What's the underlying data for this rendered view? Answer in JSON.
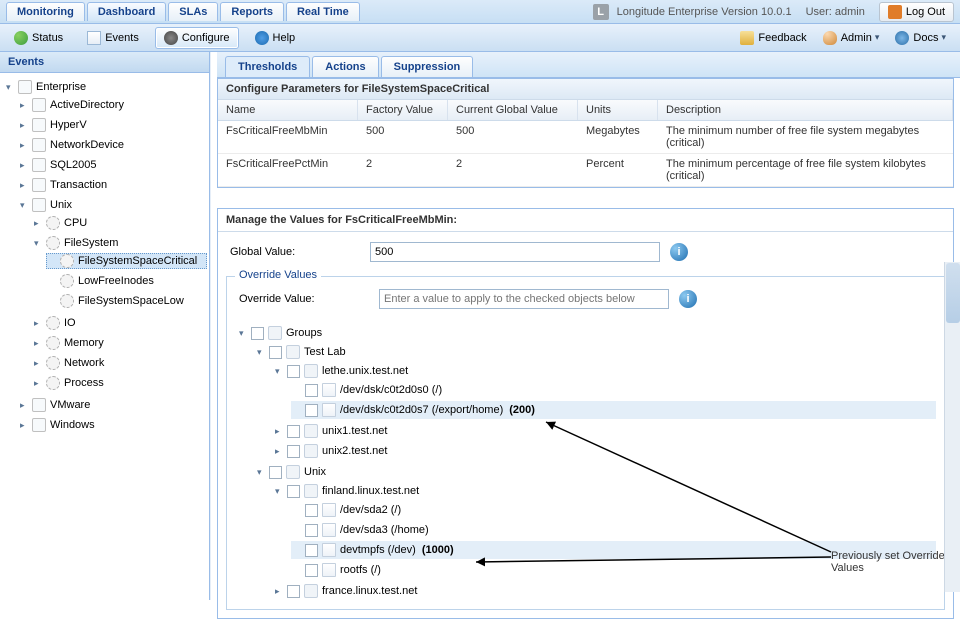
{
  "top": {
    "tabs": [
      "Monitoring",
      "Dashboard",
      "SLAs",
      "Reports",
      "Real Time"
    ],
    "active_tab": 1,
    "version": "Longitude Enterprise Version 10.0.1",
    "user_label": "User: admin",
    "logout": "Log Out"
  },
  "toolbar": {
    "status": "Status",
    "events": "Events",
    "configure": "Configure",
    "help": "Help",
    "feedback": "Feedback",
    "admin": "Admin",
    "docs": "Docs"
  },
  "sidebar": {
    "title": "Events",
    "root": "Enterprise",
    "items": [
      "ActiveDirectory",
      "HyperV",
      "NetworkDevice",
      "SQL2005",
      "Transaction"
    ],
    "unix": {
      "label": "Unix",
      "cpu": "CPU",
      "filesystem": "FileSystem",
      "fs_children": [
        "FileSystemSpaceCritical",
        "LowFreeInodes",
        "FileSystemSpaceLow"
      ],
      "others": [
        "IO",
        "Memory",
        "Network",
        "Process"
      ]
    },
    "vmware": "VMware",
    "windows": "Windows"
  },
  "subtabs": {
    "items": [
      "Thresholds",
      "Actions",
      "Suppression"
    ],
    "active": 0
  },
  "params": {
    "title": "Configure Parameters for FileSystemSpaceCritical",
    "cols": {
      "name": "Name",
      "fv": "Factory Value",
      "cgv": "Current Global Value",
      "units": "Units",
      "desc": "Description"
    },
    "rows": [
      {
        "name": "FsCriticalFreeMbMin",
        "fv": "500",
        "cgv": "500",
        "units": "Megabytes",
        "desc": "The minimum number of free file system megabytes (critical)"
      },
      {
        "name": "FsCriticalFreePctMin",
        "fv": "2",
        "cgv": "2",
        "units": "Percent",
        "desc": "The minimum percentage of free file system kilobytes (critical)"
      }
    ]
  },
  "manage": {
    "title": "Manage the Values for FsCriticalFreeMbMin:",
    "global_label": "Global Value:",
    "global_value": "500",
    "override_section": "Override Values",
    "override_label": "Override Value:",
    "override_placeholder": "Enter a value to apply to the checked objects below",
    "tree": {
      "groups": "Groups",
      "testlab": "Test Lab",
      "lethe": "lethe.unix.test.net",
      "lethe_kids": [
        {
          "label": "/dev/dsk/c0t2d0s0 (/)"
        },
        {
          "label": "/dev/dsk/c0t2d0s7 (/export/home)",
          "val": "(200)"
        }
      ],
      "unix1": "unix1.test.net",
      "unix2": "unix2.test.net",
      "unix": "Unix",
      "finland": "finland.linux.test.net",
      "finland_kids": [
        {
          "label": "/dev/sda2 (/)"
        },
        {
          "label": "/dev/sda3 (/home)"
        },
        {
          "label": "devtmpfs (/dev)",
          "val": "(1000)"
        },
        {
          "label": "rootfs (/)"
        }
      ],
      "france": "france.linux.test.net"
    }
  },
  "annotation": "Previously set Override Values"
}
